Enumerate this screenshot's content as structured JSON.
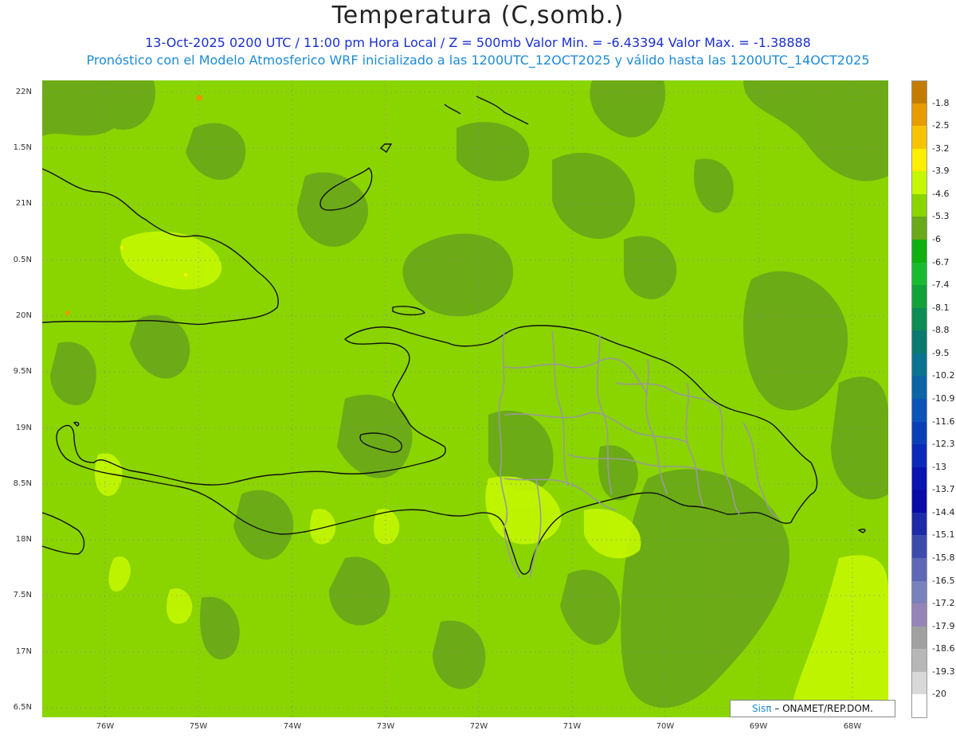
{
  "header": {
    "title": "Temperatura (C,somb.)",
    "subtitle1": "13-Oct-2025  0200 UTC / 11:00 pm Hora Local / Z = 500mb  Valor Min. = -6.43394  Valor Max. = -1.38888",
    "subtitle2": "Pronóstico con el Modelo Atmosferico WRF inicializado a las 1200UTC_12OCT2025 y válido hasta las  1200UTC_14OCT2025"
  },
  "axes": {
    "lat_labels": [
      "22N",
      "1.5N",
      "21N",
      "0.5N",
      "20N",
      "9.5N",
      "19N",
      "8.5N",
      "18N",
      "7.5N",
      "17N",
      "6.5N"
    ],
    "lon_labels": [
      "76W",
      "75W",
      "74W",
      "73W",
      "72W",
      "71W",
      "70W",
      "69W",
      "68W"
    ]
  },
  "colorbar": {
    "labels": [
      "-1.8",
      "-2.5",
      "-3.2",
      "-3.9",
      "-4.6",
      "-5.3",
      "-6",
      "-6.7",
      "-7.4",
      "-8.1",
      "-8.8",
      "-9.5",
      "-10.2",
      "-10.9",
      "-11.6",
      "-12.3",
      "-13",
      "-13.7",
      "-14.4",
      "-15.1",
      "-15.8",
      "-16.5",
      "-17.2",
      "-17.9",
      "-18.6",
      "-19.3",
      "-20"
    ],
    "colors": [
      "#c47c00",
      "#e69b00",
      "#f6c400",
      "#ffee00",
      "#c4f700",
      "#8ad400",
      "#6aa918",
      "#10b010",
      "#18bb30",
      "#13a13a",
      "#0e8c55",
      "#0a7a6e",
      "#0a7390",
      "#0a64a6",
      "#0b55b8",
      "#0b3fb8",
      "#0b2ab8",
      "#0a14b0",
      "#0a0aa8",
      "#1f2aa8",
      "#3e4bae",
      "#5d69b6",
      "#7a81bc",
      "#9585b6",
      "#a0a0a0",
      "#b7b7b7",
      "#d8d8d8",
      "#ffffff"
    ]
  },
  "credit": {
    "sis": "Sisπ",
    "text": " – ONAMET/REP.DOM."
  },
  "map": {
    "background_color": "#8ad400",
    "field": "Temperatura 500mb"
  }
}
